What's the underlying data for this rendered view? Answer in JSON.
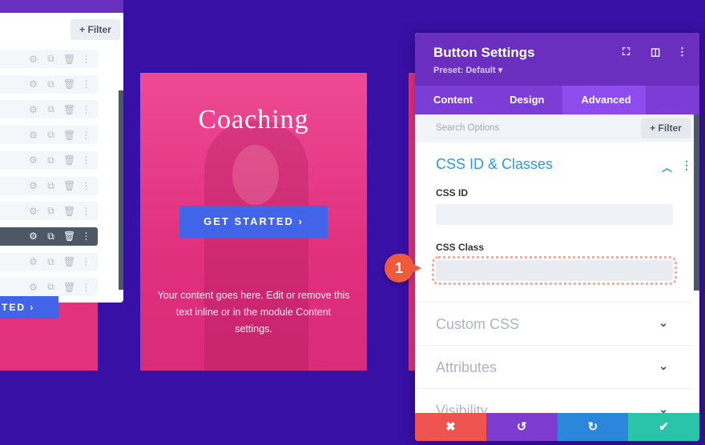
{
  "layers_panel": {
    "filter_label": "+ Filter",
    "row_count": 10,
    "selected_row": 8,
    "row_icons": [
      "gear-icon",
      "duplicate-icon",
      "trash-icon",
      "more-icon"
    ],
    "partial_button_label": "TED ›"
  },
  "card": {
    "title": "Coaching",
    "button_label": "GET STARTED  ›",
    "body_text": "Your content goes here. Edit or remove this text inline or in the module Content settings."
  },
  "settings": {
    "title": "Button Settings",
    "preset": "Preset: Default ▾",
    "tabs": [
      {
        "label": "Content"
      },
      {
        "label": "Design"
      },
      {
        "label": "Advanced",
        "active": true
      }
    ],
    "search_placeholder": "Search Options",
    "filter_label": "+ Filter",
    "section_title": "CSS ID & Classes",
    "css_id_label": "CSS ID",
    "css_id_value": "",
    "css_class_label": "CSS Class",
    "css_class_value": "",
    "collapsed_sections": [
      {
        "label": "Custom CSS"
      },
      {
        "label": "Attributes"
      },
      {
        "label": "Visibility"
      }
    ]
  },
  "badge": "1",
  "colors": {
    "background": "#3810a6",
    "header": "#6a2fbf",
    "accent_blue": "#2e9ad6",
    "cancel": "#ef5350",
    "undo": "#7e3bd0",
    "redo": "#2b87da",
    "save": "#29c4a9",
    "card_pink": "#e3327d",
    "button_blue": "#4264e8"
  }
}
